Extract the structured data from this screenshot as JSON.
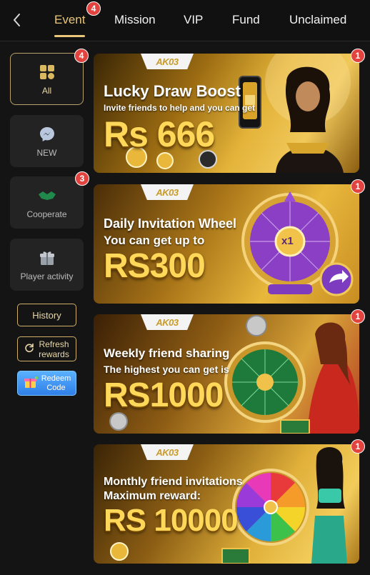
{
  "header": {
    "tabs": [
      {
        "label": "Event",
        "active": true,
        "badge": "4"
      },
      {
        "label": "Mission"
      },
      {
        "label": "VIP"
      },
      {
        "label": "Fund"
      },
      {
        "label": "Unclaimed"
      }
    ]
  },
  "sidebar": {
    "categories": [
      {
        "label": "All",
        "badge": "4",
        "icon": "grid-icon",
        "active": true
      },
      {
        "label": "NEW",
        "icon": "messenger-icon"
      },
      {
        "label": "Cooperate",
        "badge": "3",
        "icon": "handshake-icon"
      },
      {
        "label": "Player activity",
        "icon": "gift-icon"
      }
    ],
    "history_label": "History",
    "refresh_label_line1": "Refresh",
    "refresh_label_line2": "rewards",
    "redeem_label_line1": "Redeem",
    "redeem_label_line2": "Code"
  },
  "banners": [
    {
      "logo": "AK03",
      "title": "Lucky Draw Boost",
      "subtitle": "Invite friends to help and you can get",
      "amount": "Rs 666",
      "badge": "1"
    },
    {
      "logo": "AK03",
      "title": "Daily Invitation Wheel",
      "subtitle": "You can get up to",
      "amount": "RS300",
      "badge": "1",
      "wheel_center": "x1"
    },
    {
      "logo": "AK03",
      "title": "Weekly friend sharing",
      "subtitle": "The highest you can get is",
      "amount": "RS1000",
      "badge": "1"
    },
    {
      "logo": "AK03",
      "title": "Monthly friend invitations",
      "subtitle": "Maximum reward:",
      "amount": "RS 10000",
      "badge": "1"
    }
  ],
  "colors": {
    "accent_gold": "#e8c77a",
    "badge_red": "#e2433f",
    "background": "#141414",
    "redeem_blue": "#2f7fe8"
  }
}
